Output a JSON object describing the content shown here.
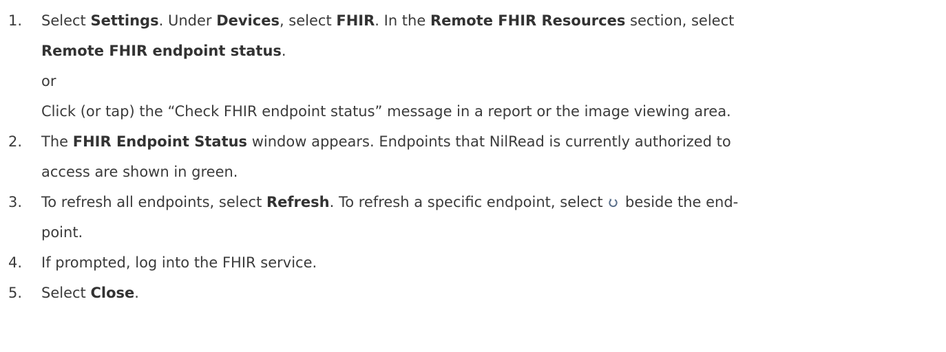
{
  "steps": [
    {
      "number": "1.",
      "line1": [
        "Select ",
        "Settings",
        ". Under ",
        "Devices",
        ", select ",
        "FHIR",
        ". In the ",
        "Remote FHIR Resources",
        " section, select"
      ],
      "line2": [
        "Remote FHIR endpoint status",
        "."
      ],
      "or_text": "or",
      "line3": "Click (or tap) the “Check FHIR endpoint status” message in a report or the image viewing area."
    },
    {
      "number": "2.",
      "line1": [
        "The ",
        "FHIR Endpoint Status",
        " window appears. Endpoints that NilRead is currently authorized to"
      ],
      "line2": "access are shown in green."
    },
    {
      "number": "3.",
      "line1": [
        "To refresh all endpoints, select ",
        "Refresh",
        ". To refresh a specific endpoint, select ",
        " beside the end-"
      ],
      "line2": "point.",
      "icon": "refresh-icon"
    },
    {
      "number": "4.",
      "line1": "If prompted, log into the FHIR service."
    },
    {
      "number": "5.",
      "line1": [
        "Select ",
        "Close",
        "."
      ]
    }
  ],
  "colors": {
    "text": "#3b3b3b",
    "icon": "#5a6f8a"
  }
}
